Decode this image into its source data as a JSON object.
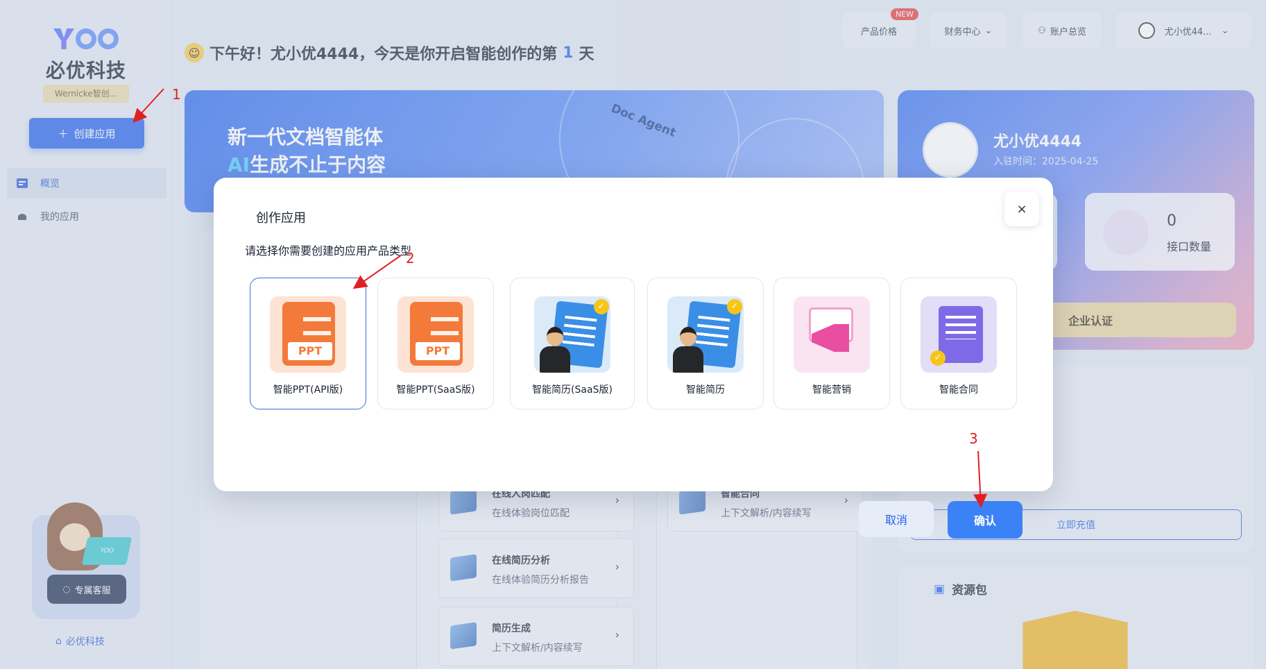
{
  "sidebar": {
    "logo_mark": "YOO",
    "logo_text": "必优科技",
    "tag": "Wernicke智创...",
    "create_button": "创建应用",
    "items": [
      {
        "label": "概览",
        "icon": "dashboard-icon"
      },
      {
        "label": "我的应用",
        "icon": "apps-icon"
      }
    ],
    "service": {
      "label": "专属客服",
      "laptop_text": "YOO"
    },
    "footer": "必优科技"
  },
  "header": {
    "greeting_prefix": "下午好！尤小优4444，今天是你开启智能创作的第",
    "greeting_days": "1",
    "greeting_suffix": "天",
    "buttons": {
      "pricing": "产品价格",
      "pricing_badge": "NEW",
      "finance": "财务中心",
      "account": "账户总览",
      "user": "尤小优44..."
    }
  },
  "banner": {
    "line1": "新一代文档智能体",
    "line2_accent": "AI",
    "line2_rest": "生成不止于内容",
    "tag": "Doc Agent"
  },
  "profile": {
    "name": "尤小优4444",
    "join_date": "入驻时间：2025-04-25",
    "api_count_value": "0",
    "api_count_label": "接口数量",
    "enterprise": "企业认证",
    "recharge": "立即充值"
  },
  "list_cards": [
    {
      "title": "在线人岗匹配",
      "subtitle": "在线体验岗位匹配"
    },
    {
      "title": "智能合同",
      "subtitle": "上下文解析/内容续写"
    },
    {
      "title": "在线简历分析",
      "subtitle": "在线体验简历分析报告"
    },
    {
      "title": "简历生成",
      "subtitle": "上下文解析/内容续写"
    }
  ],
  "resources": {
    "title": "资源包"
  },
  "modal": {
    "title": "创作应用",
    "subtitle": "请选择你需要创建的应用产品类型",
    "close": "×",
    "options": [
      {
        "label": "智能PPT(API版)",
        "badge": "PPT",
        "selected": true
      },
      {
        "label": "智能PPT(SaaS版)",
        "badge": "PPT",
        "selected": false
      },
      {
        "label": "智能简历(SaaS版)",
        "selected": false
      },
      {
        "label": "智能简历",
        "selected": false
      },
      {
        "label": "智能营销",
        "selected": false
      },
      {
        "label": "智能合同",
        "selected": false
      }
    ],
    "cancel": "取消",
    "confirm": "确认"
  },
  "annotations": [
    "1",
    "2",
    "3"
  ],
  "colors": {
    "primary": "#2563eb",
    "annotation": "#e02020",
    "ppt": "#f47a3a"
  }
}
